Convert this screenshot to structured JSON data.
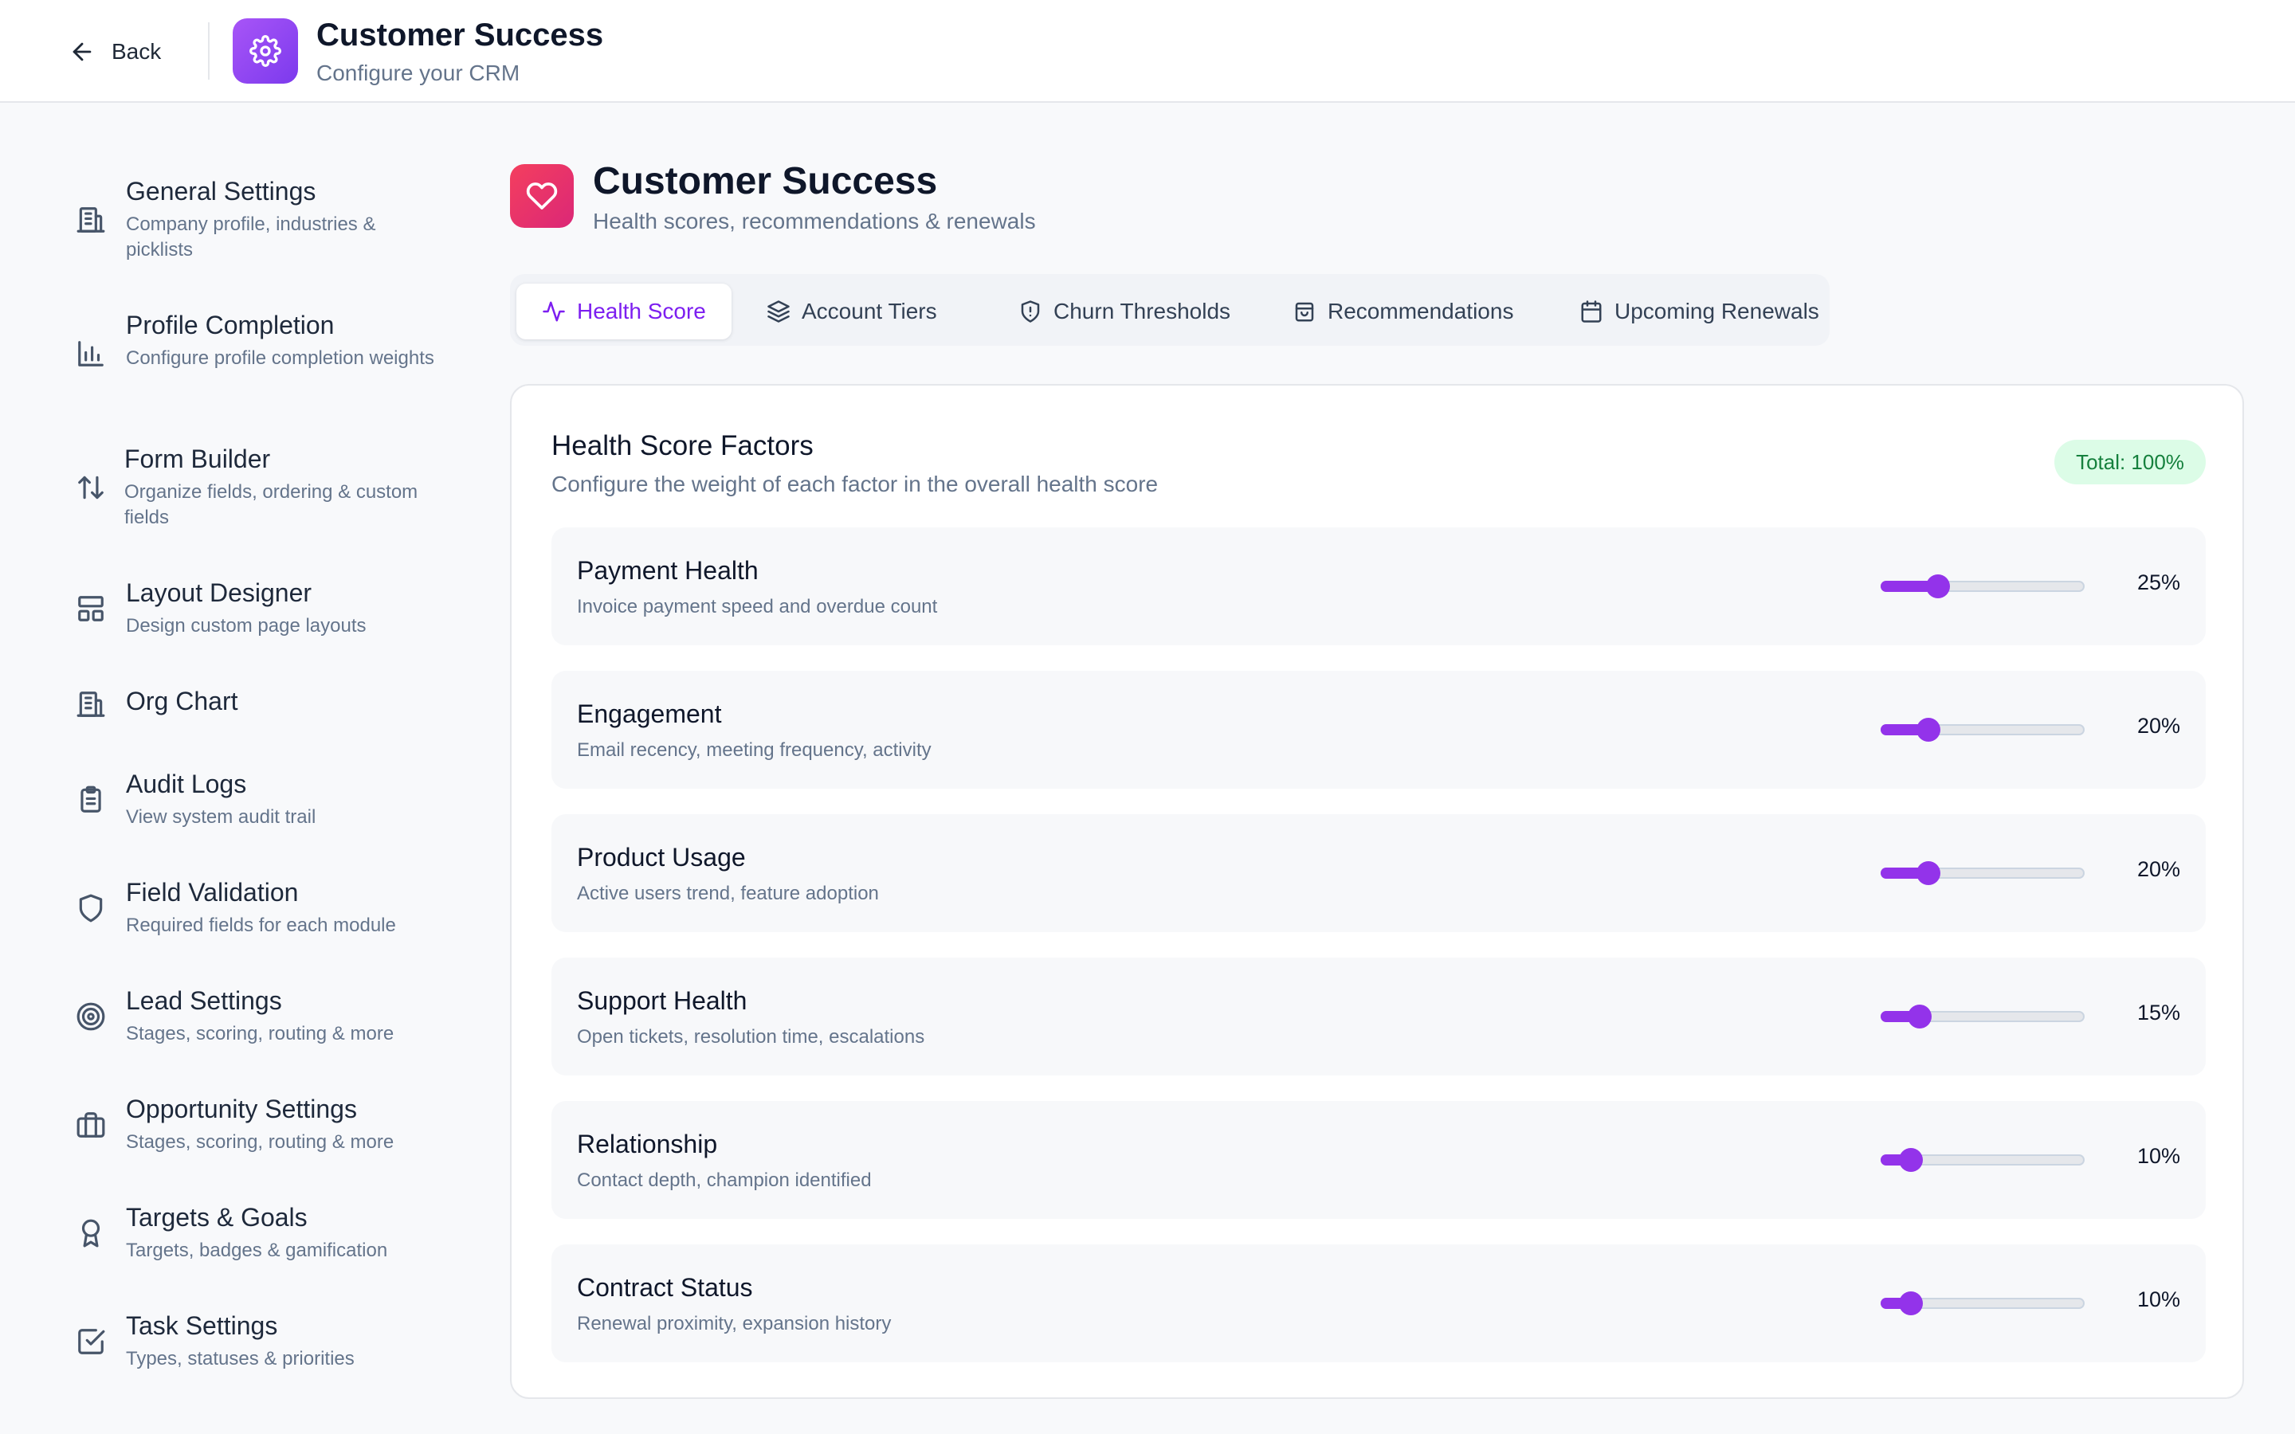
{
  "header": {
    "back_label": "Back",
    "app_title": "Customer Success",
    "app_subtitle": "Configure your CRM",
    "icon": "gear-icon"
  },
  "sidebar": {
    "items": [
      {
        "title": "General Settings",
        "desc": "Company profile, industries & picklists",
        "icon": "building-icon"
      },
      {
        "title": "Profile Completion",
        "desc": "Configure profile completion weights",
        "icon": "bar-chart-icon"
      },
      {
        "title": "Form Builder",
        "desc": "Organize fields, ordering & custom fields",
        "icon": "sort-arrows-icon"
      },
      {
        "title": "Layout Designer",
        "desc": "Design custom page layouts",
        "icon": "layout-icon"
      },
      {
        "title": "Org Chart",
        "desc": "",
        "icon": "building-icon"
      },
      {
        "title": "Audit Logs",
        "desc": "View system audit trail",
        "icon": "clipboard-icon"
      },
      {
        "title": "Field Validation",
        "desc": "Required fields for each module",
        "icon": "shield-icon"
      },
      {
        "title": "Lead Settings",
        "desc": "Stages, scoring, routing & more",
        "icon": "target-icon"
      },
      {
        "title": "Opportunity Settings",
        "desc": "Stages, scoring, routing & more",
        "icon": "briefcase-icon"
      },
      {
        "title": "Targets & Goals",
        "desc": "Targets, badges & gamification",
        "icon": "award-icon"
      },
      {
        "title": "Task Settings",
        "desc": "Types, statuses & priorities",
        "icon": "check-square-icon"
      }
    ]
  },
  "page": {
    "title": "Customer Success",
    "subtitle": "Health scores, recommendations & renewals",
    "icon": "heart-icon"
  },
  "tabs": [
    {
      "label": "Health Score",
      "icon": "activity-icon",
      "active": true
    },
    {
      "label": "Account Tiers",
      "icon": "layers-icon",
      "active": false
    },
    {
      "label": "Churn Thresholds",
      "icon": "shield-alert-icon",
      "active": false
    },
    {
      "label": "Recommendations",
      "icon": "shopping-bag-icon",
      "active": false
    },
    {
      "label": "Upcoming Renewals",
      "icon": "calendar-icon",
      "active": false
    }
  ],
  "card": {
    "title": "Health Score Factors",
    "subtitle": "Configure the weight of each factor in the overall health score",
    "total_label": "Total: 100%"
  },
  "factors": [
    {
      "name": "Payment Health",
      "desc": "Invoice payment speed and overdue count",
      "value": 25,
      "label": "25%"
    },
    {
      "name": "Engagement",
      "desc": "Email recency, meeting frequency, activity",
      "value": 20,
      "label": "20%"
    },
    {
      "name": "Product Usage",
      "desc": "Active users trend, feature adoption",
      "value": 20,
      "label": "20%"
    },
    {
      "name": "Support Health",
      "desc": "Open tickets, resolution time, escalations",
      "value": 15,
      "label": "15%"
    },
    {
      "name": "Relationship",
      "desc": "Contact depth, champion identified",
      "value": 10,
      "label": "10%"
    },
    {
      "name": "Contract Status",
      "desc": "Renewal proximity, expansion history",
      "value": 10,
      "label": "10%"
    }
  ],
  "colors": {
    "accent": "#9333ea",
    "active_tab_text": "#7c1ef0",
    "badge_bg": "#dcfce7",
    "badge_text": "#15803d"
  }
}
